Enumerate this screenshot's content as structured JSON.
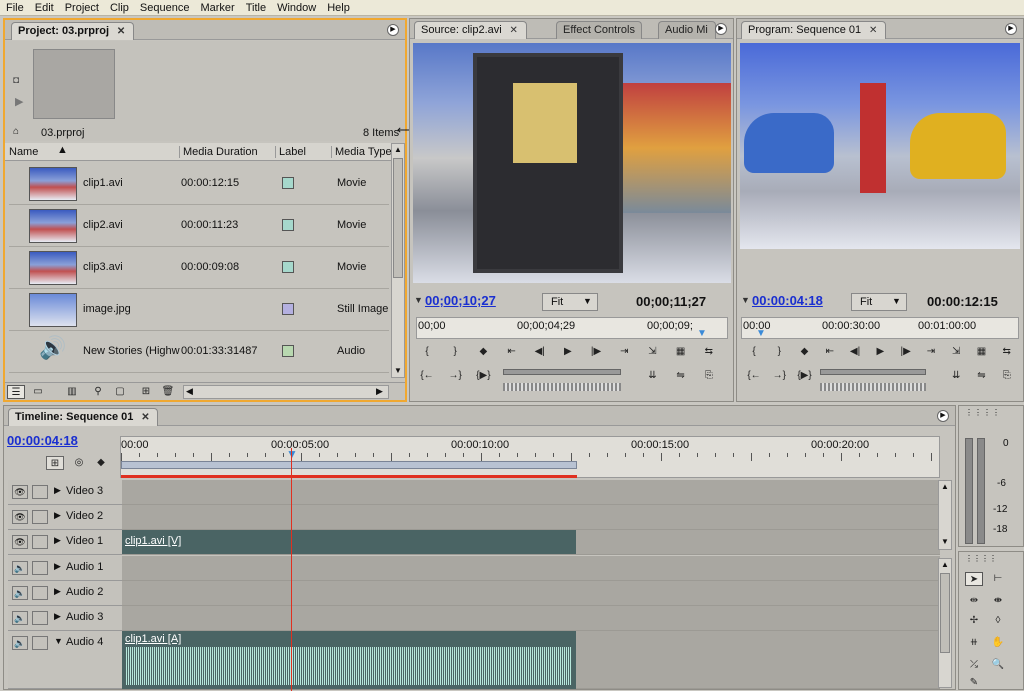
{
  "menubar": [
    "File",
    "Edit",
    "Project",
    "Clip",
    "Sequence",
    "Marker",
    "Title",
    "Window",
    "Help"
  ],
  "project": {
    "tab": "Project: 03.prproj",
    "name": "03.prproj",
    "count": "8 Items",
    "columns": [
      "Name",
      "Media Duration",
      "Label",
      "Media Type"
    ],
    "rows": [
      {
        "name": "clip1.avi",
        "duration": "00:00:12:15",
        "type": "Movie",
        "label_color": "#a6d8cc"
      },
      {
        "name": "clip2.avi",
        "duration": "00:00:11:23",
        "type": "Movie",
        "label_color": "#a6d8cc"
      },
      {
        "name": "clip3.avi",
        "duration": "00:00:09:08",
        "type": "Movie",
        "label_color": "#a6d8cc"
      },
      {
        "name": "image.jpg",
        "duration": "",
        "type": "Still Image",
        "label_color": "#b4b0e0"
      },
      {
        "name": "New Stories (Highw",
        "duration": "00:01:33:31487",
        "type": "Audio",
        "label_color": "#b8d8b0"
      }
    ]
  },
  "source": {
    "tabs": [
      "Source: clip2.avi",
      "Effect Controls",
      "Audio Mi"
    ],
    "timecode": "00;00;10;27",
    "fit": "Fit",
    "duration": "00;00;11;27",
    "ruler": [
      "00;00",
      "00;00;04;29",
      "00;00;09;"
    ]
  },
  "program": {
    "tab": "Program: Sequence 01",
    "timecode": "00:00:04:18",
    "fit": "Fit",
    "duration": "00:00:12:15",
    "ruler": [
      "00:00",
      "00:00:30:00",
      "00:01:00:00"
    ]
  },
  "timeline": {
    "tab": "Timeline: Sequence 01",
    "timecode": "00:00:04:18",
    "ruler": [
      "00:00",
      "00:00:05:00",
      "00:00:10:00",
      "00:00:15:00",
      "00:00:20:00"
    ],
    "video_tracks": [
      "Video 3",
      "Video 2",
      "Video 1"
    ],
    "audio_tracks": [
      "Audio 1",
      "Audio 2",
      "Audio 3",
      "Audio 4"
    ],
    "video_clip": "clip1.avi [V]",
    "audio_clip": "clip1.avi [A]"
  },
  "meter": {
    "labels": [
      "0",
      "-6",
      "-12",
      "-18"
    ]
  },
  "colors": {
    "timecode": "#1a2fd0",
    "playhead": "#e03020",
    "panel_active": "#f0a830",
    "video_clip": "#4a6464",
    "waveform": "#b8e8dc"
  }
}
